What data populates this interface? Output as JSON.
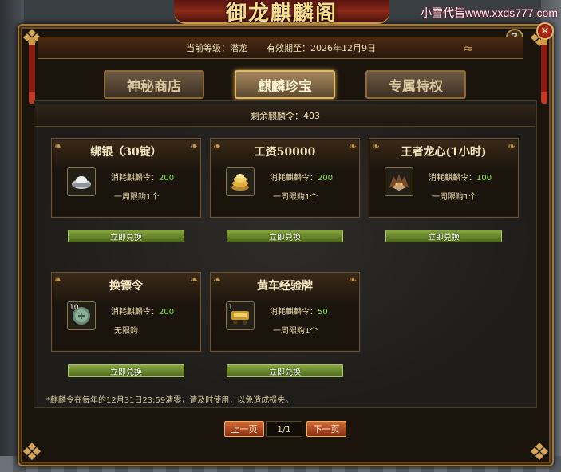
{
  "window": {
    "title": "御龙麒麟阁",
    "watermark": "小雪代售www.xxds777.com"
  },
  "header": {
    "level_label": "当前等级：潜龙",
    "valid_label": "有效期至：2026年12月9日"
  },
  "tabs": [
    {
      "label": "神秘商店",
      "active": false
    },
    {
      "label": "麒麟珍宝",
      "active": true
    },
    {
      "label": "专属特权",
      "active": false
    }
  ],
  "remaining": "剩余麒麟令：403",
  "cost_prefix": "消耗麒麟令：",
  "button_label": "立即兑换",
  "items": [
    {
      "title": "绑银（30锭）",
      "icon": "silver-ingot-icon",
      "cost": "200",
      "limit": "一周限购1个",
      "qty": ""
    },
    {
      "title": "工资50000",
      "icon": "gold-coins-icon",
      "cost": "200",
      "limit": "一周限购1个",
      "qty": ""
    },
    {
      "title": "王者龙心(1小时)",
      "icon": "dragon-heart-icon",
      "cost": "100",
      "limit": "一周限购1个",
      "qty": ""
    },
    {
      "title": "换镖令",
      "icon": "token-icon",
      "cost": "200",
      "limit": "无限购",
      "qty": "10"
    },
    {
      "title": "黄车经验牌",
      "icon": "cart-plaque-icon",
      "cost": "50",
      "limit": "一周限购1个",
      "qty": "1"
    }
  ],
  "note": "*麒麟令在每年的12月31日23:59清零，请及时使用，以免造成损失。",
  "pager": {
    "prev": "上一页",
    "page": "1/1",
    "next": "下一页"
  },
  "controls": {
    "help": "?",
    "close": "✕"
  },
  "colors": {
    "accent_gold": "#c99a45",
    "cost_green": "#8ce83a",
    "button_green": "#6b8c2c",
    "close_red": "#b22a18"
  }
}
